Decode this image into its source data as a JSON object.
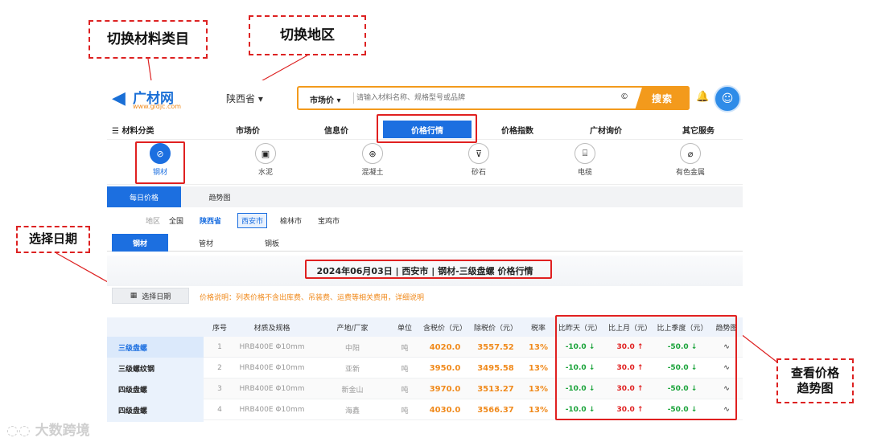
{
  "annotations": {
    "switch_category": "切换材料类目",
    "switch_region": "切换地区",
    "select_date": "选择日期",
    "view_trend_line1": "查看价格",
    "view_trend_line2": "趋势图"
  },
  "header": {
    "logo_text": "广材网",
    "logo_sub": "www.gldjc.com",
    "region": "陕西省 ▾",
    "search_type": "市场价 ▾",
    "search_placeholder": "请输入材料名称、规格型号或品牌",
    "search_clear": "©",
    "search_button": "搜索"
  },
  "nav": {
    "menu": "☰ 材料分类",
    "items": [
      "市场价",
      "信息价",
      "价格行情",
      "价格指数",
      "广材询价",
      "其它服务"
    ]
  },
  "categories": [
    "钢材",
    "水泥",
    "混凝土",
    "砂石",
    "电缆",
    "有色金属"
  ],
  "subtabs": [
    "每日价格",
    "趋势图"
  ],
  "regions": {
    "label": "地区",
    "all": "全国",
    "province": "陕西省",
    "cities": [
      "西安市",
      "榆林市",
      "宝鸡市"
    ]
  },
  "material_tabs": [
    "钢材",
    "管材",
    "钢板"
  ],
  "banner_title": "2024年06月03日 | 西安市 | 钢材-三级盘螺 价格行情",
  "date_button": "选择日期",
  "price_note": "价格说明：列表价格不含出库费、吊装费、运费等相关费用，详细说明",
  "table": {
    "headers": [
      "序号",
      "材质及规格",
      "产地/厂家",
      "单位",
      "含税价（元）",
      "除税价（元）",
      "税率",
      "比昨天（元）",
      "比上月（元）",
      "比上季度（元）",
      "趋势图"
    ],
    "left_items": [
      "三级盘螺",
      "三级螺纹钢",
      "四级盘螺",
      "四级盘螺"
    ],
    "rows": [
      {
        "no": "1",
        "spec": "HRB400E Φ10mm",
        "origin": "中阳",
        "unit": "吨",
        "tax_price": "4020.0",
        "net_price": "3557.52",
        "rate": "13%",
        "vs_yesterday": "-10.0 ↓",
        "vs_month": "30.0 ↑",
        "vs_quarter": "-50.0 ↓",
        "trend": "∿"
      },
      {
        "no": "2",
        "spec": "HRB400E Φ10mm",
        "origin": "亚新",
        "unit": "吨",
        "tax_price": "3950.0",
        "net_price": "3495.58",
        "rate": "13%",
        "vs_yesterday": "-10.0 ↓",
        "vs_month": "30.0 ↑",
        "vs_quarter": "-50.0 ↓",
        "trend": "∿"
      },
      {
        "no": "3",
        "spec": "HRB400E Φ10mm",
        "origin": "新金山",
        "unit": "吨",
        "tax_price": "3970.0",
        "net_price": "3513.27",
        "rate": "13%",
        "vs_yesterday": "-10.0 ↓",
        "vs_month": "30.0 ↑",
        "vs_quarter": "-50.0 ↓",
        "trend": "∿"
      },
      {
        "no": "4",
        "spec": "HRB400E Φ10mm",
        "origin": "海鑫",
        "unit": "吨",
        "tax_price": "4030.0",
        "net_price": "3566.37",
        "rate": "13%",
        "vs_yesterday": "-10.0 ↓",
        "vs_month": "30.0 ↑",
        "vs_quarter": "-50.0 ↓",
        "trend": "∿"
      }
    ]
  },
  "watermark": "大数跨境",
  "colors": {
    "accent": "#1c6fe0",
    "orange": "#f39a1c",
    "annotation": "#e02020",
    "up": "#e02020",
    "down": "#1aa33a"
  }
}
